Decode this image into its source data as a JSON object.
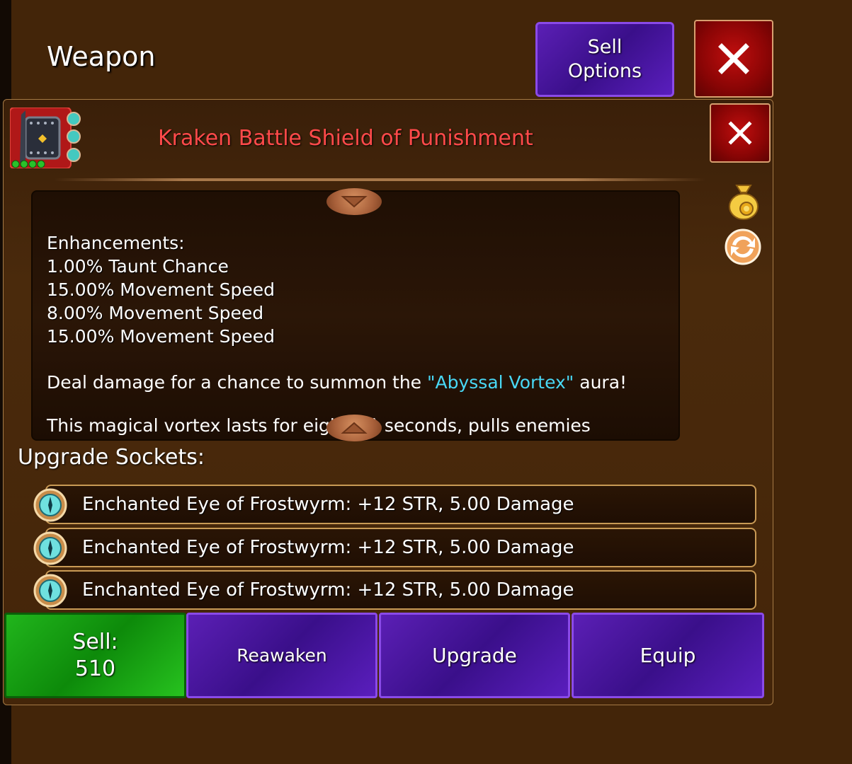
{
  "header": {
    "title": "Weapon",
    "sell_options_label": "Sell Options",
    "close_label": "X"
  },
  "item": {
    "name": "Kraken Battle Shield of Punishment",
    "name_color": "#ff4a4a",
    "icon": "shield-icon",
    "socket_count": 3,
    "level_pips": 4,
    "close_label": "X"
  },
  "description": {
    "enhancements_heading": "Enhancements:",
    "enhancements": [
      "1.00% Taunt Chance",
      "15.00% Movement Speed",
      "8.00% Movement Speed",
      "15.00% Movement Speed"
    ],
    "aura_prefix": "Deal damage for a chance to summon the ",
    "aura_name": "\"Abyssal Vortex\"",
    "aura_suffix": " aura!",
    "cut_off_text": "This magical vortex lasts for eight (8) seconds, pulls enemies"
  },
  "side_icons": [
    "gold-bag-icon",
    "swap-icon"
  ],
  "upgrade_sockets": {
    "title": "Upgrade Sockets:",
    "items": [
      {
        "label": "Enchanted Eye of Frostwyrm: +12 STR, 5.00 Damage",
        "icon": "frost-eye-gem-icon"
      },
      {
        "label": "Enchanted Eye of Frostwyrm: +12 STR, 5.00 Damage",
        "icon": "frost-eye-gem-icon"
      },
      {
        "label": "Enchanted Eye of Frostwyrm: +12 STR, 5.00 Damage",
        "icon": "frost-eye-gem-icon"
      }
    ]
  },
  "actions": {
    "sell_label": "Sell:",
    "sell_value": "510",
    "reawaken_label": "Reawaken",
    "upgrade_label": "Upgrade",
    "equip_label": "Equip"
  },
  "colors": {
    "background": "#432509",
    "purple_button": "#4a1aa0",
    "green_button": "#1aa016",
    "close_red": "#b00b0b",
    "aura_cyan": "#49d8f5"
  }
}
